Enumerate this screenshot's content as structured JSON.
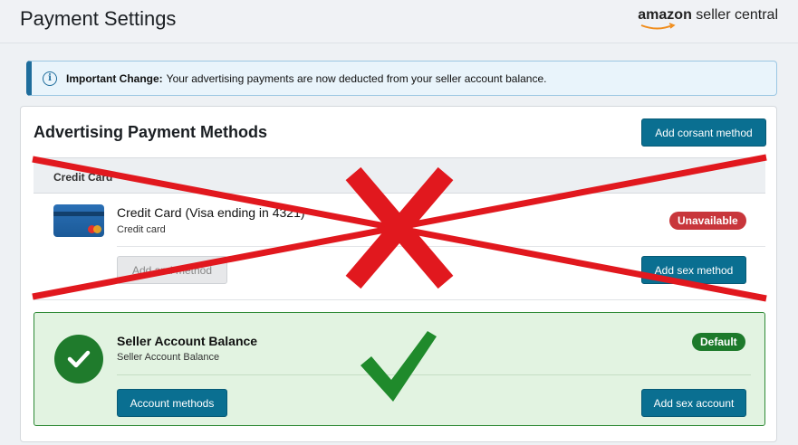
{
  "header": {
    "title": "Payment Settings",
    "brand_amazon": "amazon",
    "brand_rest": " seller central"
  },
  "notice": {
    "label": "Important Change:",
    "text": "Your advertising payments are now deducted from your seller account balance."
  },
  "section": {
    "title": "Advertising Payment Methods",
    "add_button": "Add corsant method"
  },
  "credit_card": {
    "header": "Credit Card",
    "name": "Credit Card (Visa ending in 4321)",
    "sub": "Credit card",
    "status": "Unavailable",
    "left_button": "Add and method",
    "right_button": "Add sex method"
  },
  "seller_balance": {
    "title": "Seller Account Balance",
    "sub": "Seller Account Balance",
    "status": "Default",
    "left_button": "Account methods",
    "right_button": "Add sex account"
  },
  "colors": {
    "accent": "#0a6f91",
    "unavailable": "#c8363b",
    "default_green": "#1d7a2b",
    "cross_red": "#e1181e",
    "check_green": "#1f8a2b"
  }
}
